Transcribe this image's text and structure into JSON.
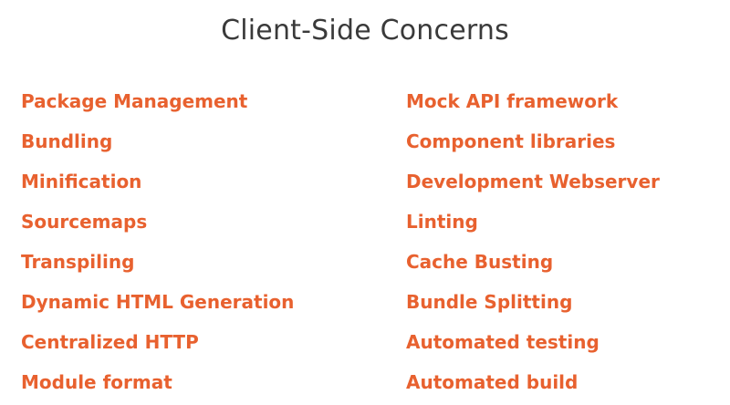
{
  "slide": {
    "title": "Client-Side Concerns",
    "title_color": "#3a3a3a",
    "accent_color": "#e8612f",
    "left_items": [
      "Package Management",
      "Bundling",
      "Minification",
      "Sourcemaps",
      "Transpiling",
      "Dynamic HTML Generation",
      "Centralized HTTP",
      "Module format"
    ],
    "right_items": [
      "Mock API framework",
      "Component libraries",
      "Development Webserver",
      "Linting",
      "Cache Busting",
      "Bundle Splitting",
      "Automated testing",
      "Automated build"
    ]
  }
}
